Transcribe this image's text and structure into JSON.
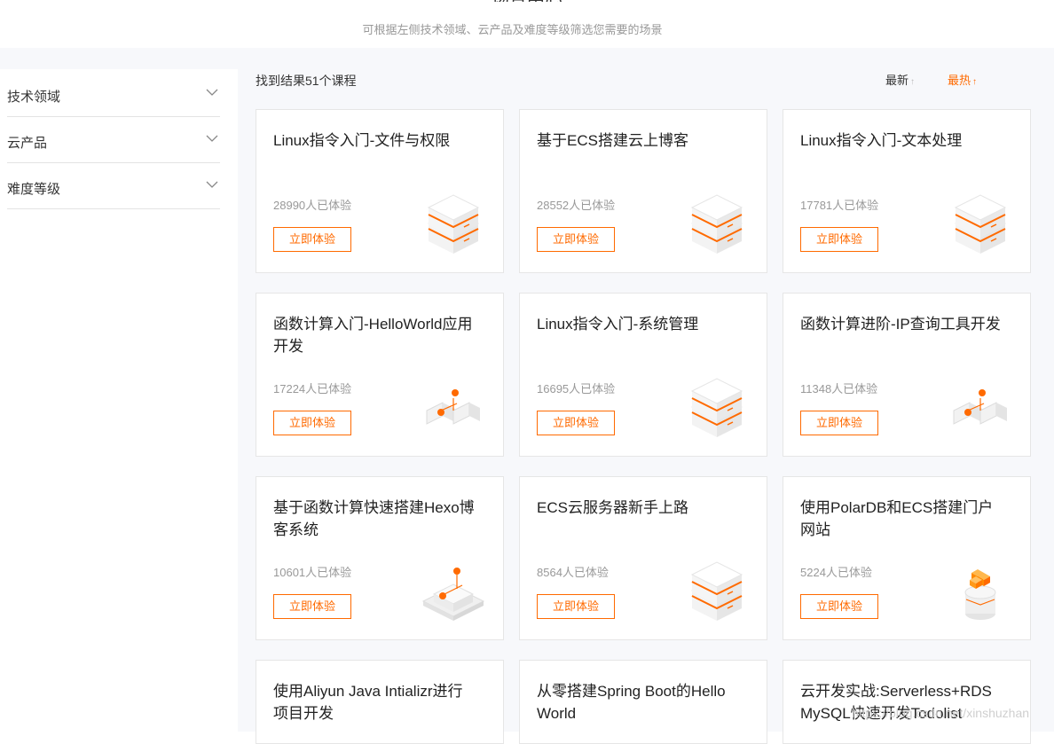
{
  "header": {
    "subtitle": "可根据左侧技术领域、云产品及难度等级筛选您需要的场景"
  },
  "filters": [
    {
      "label": "技术领域"
    },
    {
      "label": "云产品"
    },
    {
      "label": "难度等级"
    }
  ],
  "results_text": "找到结果51个课程",
  "sort": {
    "latest": "最新",
    "hot": "最热"
  },
  "courses": [
    {
      "title": "Linux指令入门-文件与权限",
      "count": "28990人已体验",
      "button": "立即体验",
      "icon": "server-cube-icon"
    },
    {
      "title": "基于ECS搭建云上博客",
      "count": "28552人已体验",
      "button": "立即体验",
      "icon": "server-cube-icon"
    },
    {
      "title": "Linux指令入门-文本处理",
      "count": "17781人已体验",
      "button": "立即体验",
      "icon": "server-cube-icon"
    },
    {
      "title": "函数计算入门-HelloWorld应用开发",
      "count": "17224人已体验",
      "button": "立即体验",
      "icon": "function-blocks-icon"
    },
    {
      "title": "Linux指令入门-系统管理",
      "count": "16695人已体验",
      "button": "立即体验",
      "icon": "server-cube-icon"
    },
    {
      "title": "函数计算进阶-IP查询工具开发",
      "count": "11348人已体验",
      "button": "立即体验",
      "icon": "function-blocks-icon"
    },
    {
      "title": "基于函数计算快速搭建Hexo博客系统",
      "count": "10601人已体验",
      "button": "立即体验",
      "icon": "function-platform-icon"
    },
    {
      "title": "ECS云服务器新手上路",
      "count": "8564人已体验",
      "button": "立即体验",
      "icon": "server-cube-icon"
    },
    {
      "title": "使用PolarDB和ECS搭建门户网站",
      "count": "5224人已体验",
      "button": "立即体验",
      "icon": "polardb-stack-icon"
    },
    {
      "title": "使用Aliyun Java Intializr进行项目开发",
      "count": "",
      "button": "",
      "icon": ""
    },
    {
      "title": "从零搭建Spring Boot的Hello World",
      "count": "",
      "button": "",
      "icon": ""
    },
    {
      "title": "云开发实战:Serverless+RDS MySQL快速开发Todolist",
      "count": "",
      "button": "",
      "icon": ""
    }
  ],
  "watermark": "https://blog.csdn.net/xinshuzhan",
  "colors": {
    "accent": "#ff6a00",
    "band": "#f7f8fb"
  }
}
